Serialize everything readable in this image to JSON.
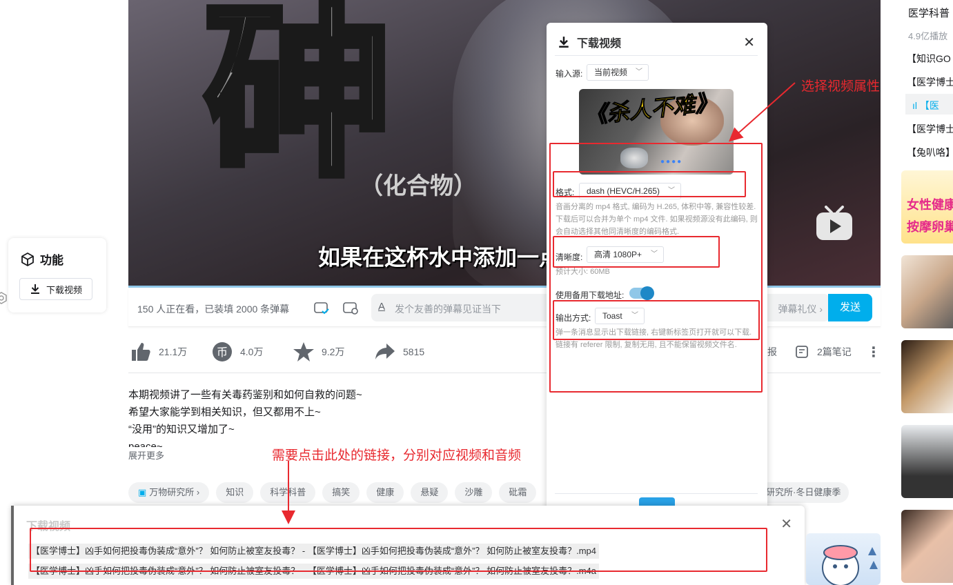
{
  "video": {
    "big_char": "砷",
    "sub_char": "（化合物）",
    "caption": "如果在这杯水中添加一点"
  },
  "danmaku": {
    "viewers": "150 人正在看，已装填 2000 条弹幕",
    "input_placeholder": "发个友善的弹幕见证当下",
    "etiquette": "弹幕礼仪 ›",
    "send": "发送"
  },
  "actions": {
    "like": "21.1万",
    "coin": "4.0万",
    "favorite": "9.2万",
    "share": "5815",
    "report": "报",
    "notes": "2篇笔记"
  },
  "description": {
    "lines": [
      "本期视频讲了一些有关毒药鉴别和如何自救的问题~",
      "希望大家能学到相关知识，但又都用不上~",
      "“没用”的知识又增加了~",
      "peace~"
    ],
    "more": "展开更多"
  },
  "tags": [
    "万物研究所 ›",
    "知识",
    "科学科普",
    "搞笑",
    "健康",
    "悬疑",
    "沙雕",
    "砒霜"
  ],
  "tag_right": "研究所·冬日健康季",
  "feature_panel": {
    "title": "功能",
    "download_button": "下载视频"
  },
  "sidebar": {
    "items": [
      "医学科普",
      "4.9亿播放",
      "【知识GO",
      "【医学博士",
      "【医",
      "【医学博士",
      "【兔叭咯】"
    ],
    "thumb_texts": [
      "女性健康",
      "按摩卵巢"
    ]
  },
  "download_modal": {
    "title": "下载视频",
    "input_source_label": "输入源:",
    "input_source_value": "当前视频",
    "thumb_title": "《杀人不难》",
    "format_label": "格式:",
    "format_value": "dash (HEVC/H.265)",
    "format_hint": "音画分离的 mp4 格式, 编码为 H.265, 体积中等, 兼容性较差. 下载后可以合并为单个 mp4 文件. 如果视频源没有此编码, 则会自动选择其他同清晰度的编码格式.",
    "quality_label": "清晰度:",
    "quality_value": "高清 1080P+",
    "size_hint": "预计大小: 60MB",
    "backup_label": "使用备用下载地址:",
    "backup_on": true,
    "output_label": "输出方式:",
    "output_value": "Toast",
    "output_hint": "弹一条消息显示出下载链接, 右键新标签页打开就可以下载. 链接有 referer 限制, 复制无用, 且不能保留视频文件名.",
    "close": "✕"
  },
  "bottom_panel": {
    "title": "下载视频",
    "close": "✕",
    "links": [
      "【医学博士】凶手如何把投毒伪装成“意外”？  如何防止被室友投毒？ - 【医学博士】凶手如何把投毒伪装成“意外”？  如何防止被室友投毒？.mp4",
      "【医学博士】凶手如何把投毒伪装成“意外”？  如何防止被室友投毒？ - 【医学博士】凶手如何把投毒伪装成“意外”？  如何防止被室友投毒？.m4a"
    ]
  },
  "annotations": {
    "select_props": "选择视频属性",
    "click_links": "需要点击此处的链接，分别对应视频和音频"
  },
  "colors": {
    "accent": "#00aeec",
    "annotation": "#e8292f"
  }
}
